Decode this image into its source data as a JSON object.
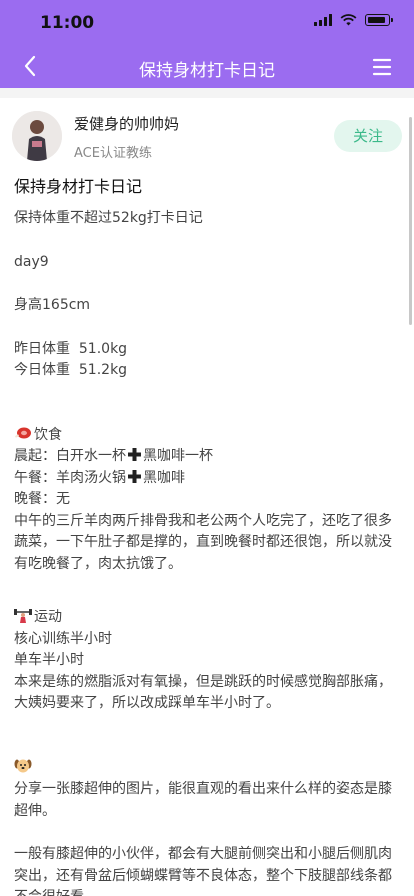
{
  "status": {
    "time": "11:00"
  },
  "nav": {
    "title": "保持身材打卡日记"
  },
  "author": {
    "name": "爱健身的帅帅妈",
    "title": "ACE认证教练",
    "follow_label": "关注"
  },
  "article": {
    "title": "保持身材打卡日记",
    "subtitle": "保持体重不超过52kg打卡日记",
    "day": "day9",
    "height": "身高165cm",
    "weight_yesterday": "昨日体重  51.0kg",
    "weight_today": "今日体重  51.2kg",
    "diet": {
      "heading": "饮食",
      "breakfast_a": "晨起：白开水一杯",
      "breakfast_b": "黑咖啡一杯",
      "lunch_a": "午餐：羊肉汤火锅",
      "lunch_b": "黑咖啡",
      "dinner": "晚餐：无",
      "note": "中午的三斤羊肉两斤排骨我和老公两个人吃完了，还吃了很多蔬菜，一下午肚子都是撑的，直到晚餐时都还很饱，所以就没有吃晚餐了，肉太抗饿了。"
    },
    "exercise": {
      "heading": "运动",
      "core": "核心训练半小时",
      "bike": "单车半小时",
      "note": "本来是练的燃脂派对有氧操，但是跳跃的时候感觉胸部胀痛，大姨妈要来了，所以改成踩单车半小时了。"
    },
    "posture": {
      "intro": "分享一张膝超伸的图片，能很直观的看出来什么样的姿态是膝超伸。",
      "para": "一般有膝超伸的小伙伴，都会有大腿前侧突出和小腿后侧肌肉突出，还有骨盆后倾蝴蝶臂等不良体态，整个下肢腿部线条都不会很好看。"
    }
  },
  "icons": {
    "back": "chevron-left-icon",
    "menu": "menu-icon",
    "diet": "meat-icon",
    "exercise": "dumbbell-person-icon",
    "dog": "dog-face-icon",
    "plus": "plus-icon"
  },
  "colors": {
    "header": "#9b6cf0",
    "follow_bg": "#e3f6ee",
    "follow_text": "#3cb98a"
  }
}
